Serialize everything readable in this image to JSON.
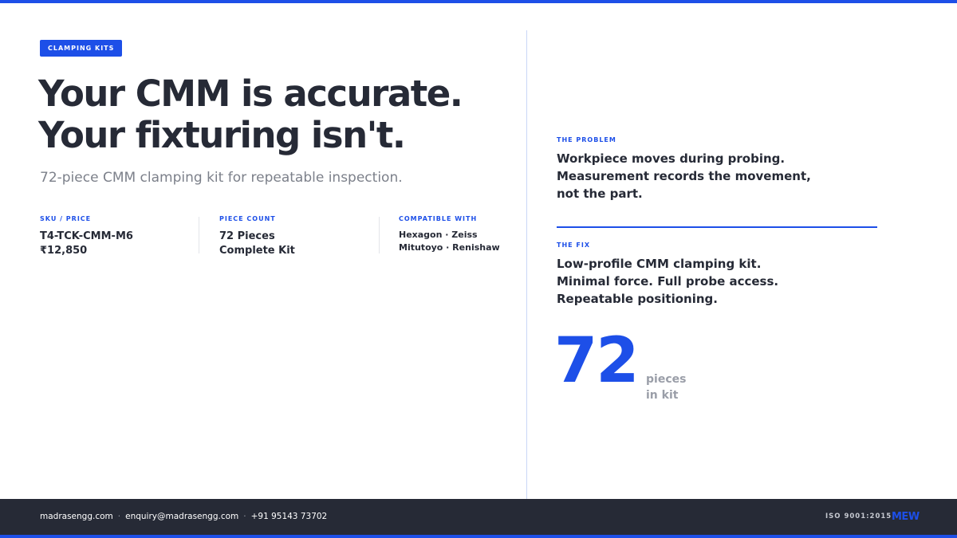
{
  "tag": "CLAMPING KITS",
  "headline": {
    "line1": "Your CMM is accurate.",
    "line2": "Your fixturing isn't."
  },
  "subtitle": "72-piece CMM clamping kit for repeatable inspection.",
  "specs": [
    {
      "label": "SKU / PRICE",
      "line1": "T4-TCK-CMM-M6",
      "line2": "₹12,850"
    },
    {
      "label": "PIECE COUNT",
      "line1": "72 Pieces",
      "line2": "Complete Kit"
    },
    {
      "label": "COMPATIBLE WITH",
      "line1": "Hexagon · Zeiss",
      "line2": "Mitutoyo · Renishaw"
    }
  ],
  "problem": {
    "label": "THE PROBLEM",
    "lines": [
      "Workpiece moves during probing.",
      "Measurement records the movement,",
      "not the part."
    ]
  },
  "fix": {
    "label": "THE FIX",
    "lines": [
      "Low-profile CMM clamping kit.",
      "Minimal force. Full probe access.",
      "Repeatable positioning."
    ]
  },
  "highlight": {
    "number": "72",
    "caption_line1": "pieces",
    "caption_line2": "in kit"
  },
  "footer": {
    "website": "madrasengg.com",
    "email": "enquiry@madrasengg.com",
    "phone": "+91 95143 73702",
    "separator": "·",
    "certification": "ISO 9001:2015",
    "brand": "MEW"
  },
  "colors": {
    "accent": "#1d4fe8",
    "text": "#262a36",
    "muted": "#7c808a",
    "footer_bg": "#262a36"
  }
}
